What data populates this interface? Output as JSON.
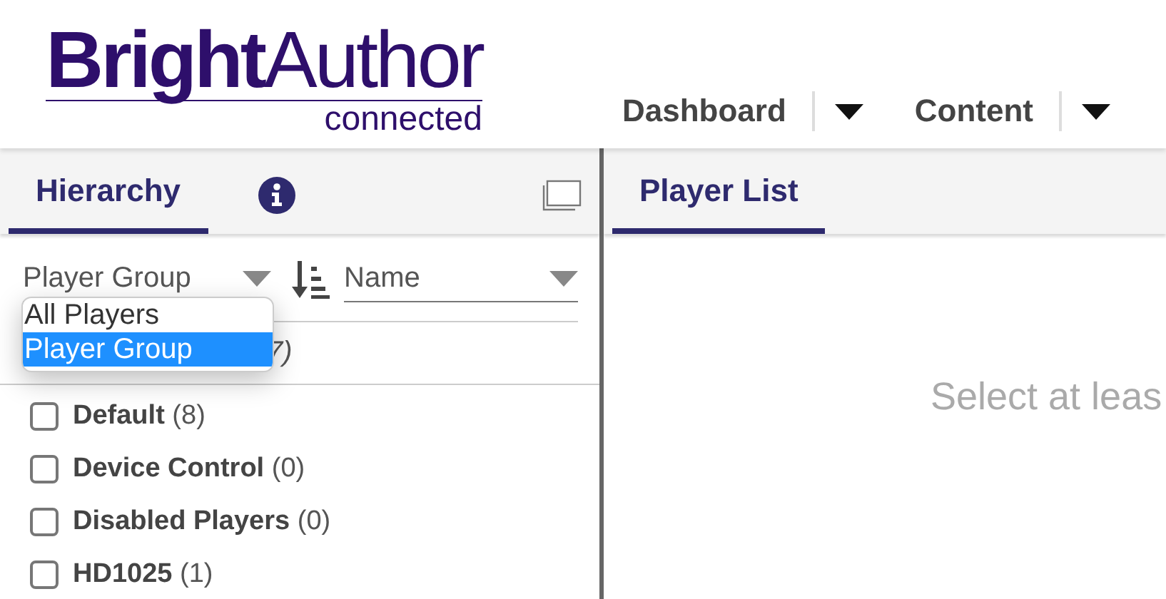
{
  "logo": {
    "bold": "Bright",
    "regular": "Author",
    "sub": "connected"
  },
  "nav": [
    {
      "label": "Dashboard",
      "selected": false
    },
    {
      "label": "Content",
      "selected": false
    }
  ],
  "left_tabs": [
    {
      "label": "Hierarchy",
      "selected": true
    }
  ],
  "filter": {
    "value": "Player Group",
    "options": [
      {
        "label": "All Players",
        "selected": false
      },
      {
        "label": "Player Group",
        "selected": true
      }
    ]
  },
  "sort": {
    "value": "Name"
  },
  "all_row_visible_text": "7)",
  "groups": [
    {
      "name": "Default",
      "count": "(8)",
      "checked": false
    },
    {
      "name": "Device Control",
      "count": "(0)",
      "checked": false
    },
    {
      "name": "Disabled Players",
      "count": "(0)",
      "checked": false
    },
    {
      "name": "HD1025",
      "count": "(1)",
      "checked": false
    }
  ],
  "right_tabs": [
    {
      "label": "Player List",
      "selected": true
    }
  ],
  "empty_message": "Select at leas"
}
